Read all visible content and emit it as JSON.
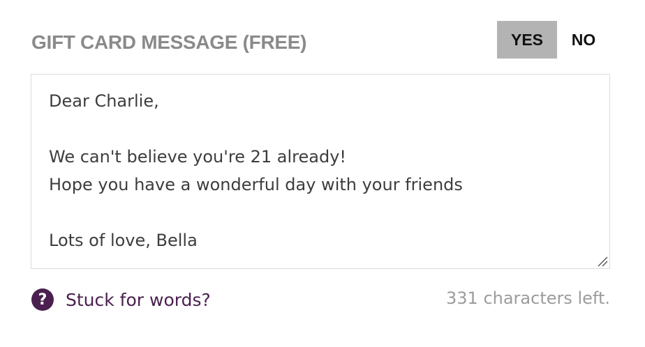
{
  "header": {
    "title": "GIFT CARD MESSAGE (FREE)"
  },
  "toggle": {
    "yes_label": "YES",
    "no_label": "NO",
    "selected": "YES"
  },
  "message": {
    "value": "Dear Charlie,\n\nWe can't believe you're 21 already!\nHope you have a wonderful day with your friends\n\nLots of love, Bella"
  },
  "help": {
    "icon": "question-circle-icon",
    "label": "Stuck for words?"
  },
  "counter": {
    "text": "331 characters left."
  },
  "colors": {
    "accent": "#4a1f4f",
    "toggle_selected_bg": "#b3b3b3",
    "title": "#8a8a8a",
    "muted": "#9c9c9c"
  }
}
